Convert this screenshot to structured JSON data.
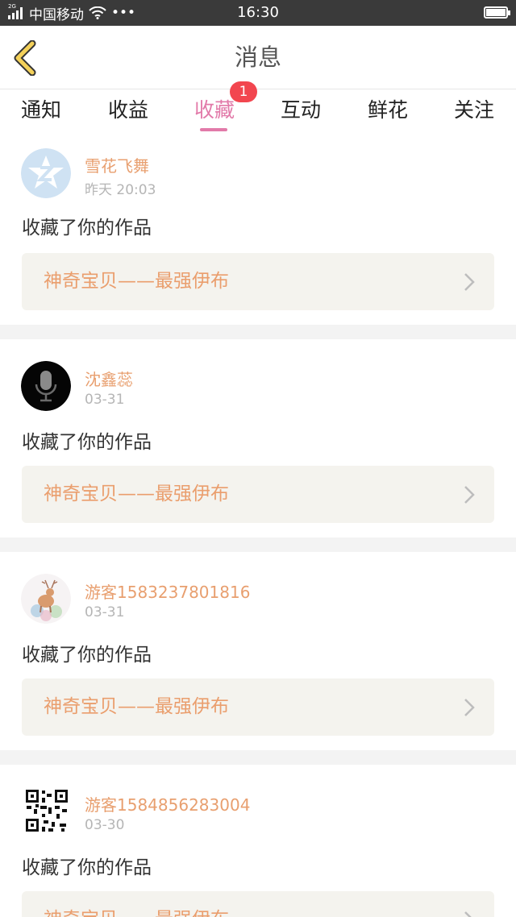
{
  "status_bar": {
    "network_gen": "2G",
    "carrier": "中国移动",
    "more": "•••",
    "time": "16:30"
  },
  "nav": {
    "title": "消息"
  },
  "tabs": [
    {
      "label": "通知"
    },
    {
      "label": "收益"
    },
    {
      "label": "收藏",
      "active": true,
      "badge": "1"
    },
    {
      "label": "互动"
    },
    {
      "label": "鲜花"
    },
    {
      "label": "关注"
    }
  ],
  "colors": {
    "accent_pink": "#e27aa9",
    "username": "#e89f6f",
    "work_title": "#ea9e6d",
    "badge": "#f2464f"
  },
  "messages": [
    {
      "username": "雪花飞舞",
      "time": "昨天 20:03",
      "action": "收藏了你的作品",
      "work_title": "神奇宝贝——最强伊布",
      "avatar": "z-logo-avatar"
    },
    {
      "username": "沈鑫蕊",
      "time": "03-31",
      "action": "收藏了你的作品",
      "work_title": "神奇宝贝——最强伊布",
      "avatar": "microphone-avatar"
    },
    {
      "username": "游客1583237801816",
      "time": "03-31",
      "action": "收藏了你的作品",
      "work_title": "神奇宝贝——最强伊布",
      "avatar": "deer-illustration-avatar"
    },
    {
      "username": "游客1584856283004",
      "time": "03-30",
      "action": "收藏了你的作品",
      "work_title": "神奇宝贝——最强伊布",
      "avatar": "qr-code-avatar"
    }
  ]
}
